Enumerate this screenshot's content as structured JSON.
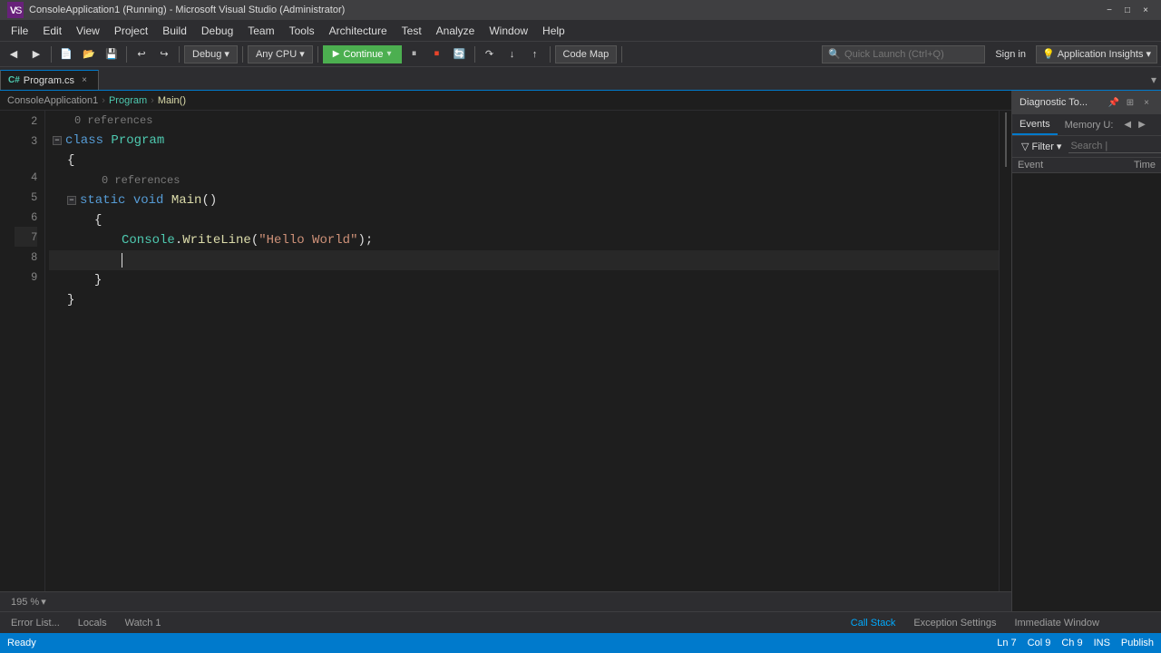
{
  "titleBar": {
    "logo": "VS",
    "title": "ConsoleApplication1 (Running) - Microsoft Visual Studio (Administrator)",
    "minimize": "−",
    "maximize": "□",
    "close": "×"
  },
  "menuBar": {
    "items": [
      "File",
      "Edit",
      "View",
      "Project",
      "Build",
      "Debug",
      "Team",
      "Tools",
      "Architecture",
      "Test",
      "Analyze",
      "Window",
      "Help"
    ]
  },
  "toolbar": {
    "debugMode": "Debug",
    "cpuTarget": "Any CPU",
    "continueLabel": "Continue",
    "codeMapLabel": "Code Map",
    "appInsightsLabel": "Application Insights",
    "quickLaunchPlaceholder": "Quick Launch (Ctrl+Q)"
  },
  "signin": {
    "label": "Sign in"
  },
  "tabBar": {
    "tabs": [
      {
        "name": "Program.cs",
        "active": true,
        "icon": "CS",
        "modified": false
      },
      {
        "name": "×",
        "active": false,
        "isClose": true
      }
    ]
  },
  "breadcrumb": {
    "items": [
      "ConsoleApplication1",
      "Program",
      "Main()"
    ]
  },
  "editor": {
    "zoomLevel": "195 %",
    "lines": [
      {
        "num": "2",
        "indent": 0,
        "content": "class Program",
        "type": "class-decl",
        "hasCollapse": true,
        "hint": null
      },
      {
        "num": "3",
        "indent": 1,
        "content": "{",
        "type": "punct",
        "hasCollapse": false,
        "hint": null
      },
      {
        "num": "4",
        "indent": 2,
        "content": "static void Main()",
        "type": "method-decl",
        "hasCollapse": true,
        "hint": "0 references"
      },
      {
        "num": "5",
        "indent": 3,
        "content": "{",
        "type": "punct",
        "hasCollapse": false,
        "hint": null
      },
      {
        "num": "6",
        "indent": 4,
        "content": "Console.WriteLine(\"Hello World\");",
        "type": "statement",
        "hasCollapse": false,
        "hint": null
      },
      {
        "num": "7",
        "indent": 0,
        "content": "",
        "type": "empty",
        "hasCollapse": false,
        "hint": null
      },
      {
        "num": "8",
        "indent": 3,
        "content": "}",
        "type": "punct",
        "hasCollapse": false,
        "hint": null
      },
      {
        "num": "9",
        "indent": 1,
        "content": "}",
        "type": "punct",
        "hasCollapse": false,
        "hint": null
      }
    ],
    "hintAbove": "0 references",
    "statusLine": "Ln 7",
    "statusCol": "Col 9",
    "statusCh": "Ch 9",
    "statusIns": "INS"
  },
  "diagnosticTools": {
    "title": "Diagnostic To...",
    "tabs": [
      "Events",
      "Memory U:"
    ],
    "filterLabel": "Filter",
    "searchPlaceholder": "Search |",
    "columns": [
      "Event",
      "Time"
    ]
  },
  "bottomTabs": {
    "left": [
      "Error List...",
      "Locals",
      "Watch 1"
    ],
    "right": [
      "Call Stack",
      "Exception Settings",
      "Immediate Window"
    ],
    "zoomLabel": "195 %"
  },
  "statusBar": {
    "ready": "Ready",
    "line": "Ln 7",
    "col": "Col 9",
    "ch": "Ch 9",
    "ins": "INS",
    "publish": "Publish"
  }
}
